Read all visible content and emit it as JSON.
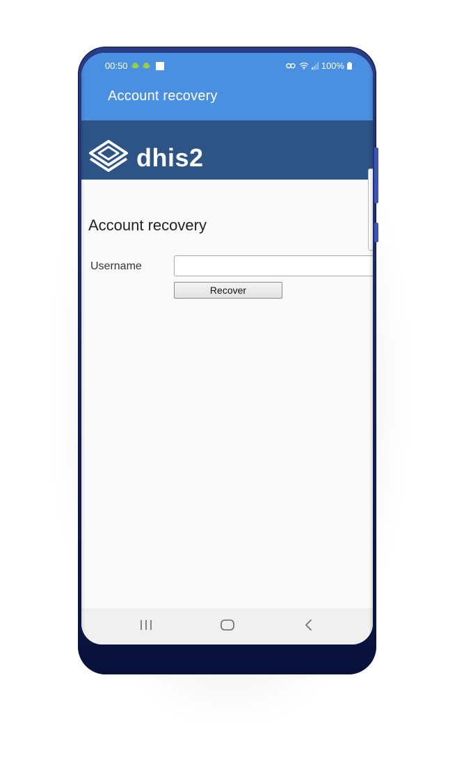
{
  "status_bar": {
    "time": "00:50",
    "battery": "100%"
  },
  "app_bar": {
    "title": "Account recovery"
  },
  "header": {
    "logo_text": "dhis2"
  },
  "form": {
    "title": "Account recovery",
    "username_label": "Username",
    "username_value": "",
    "recover_label": "Recover"
  },
  "nav": {
    "items": [
      "recents",
      "home",
      "back"
    ]
  },
  "colors": {
    "app_bar": "#4a90e2",
    "header": "#2c5485",
    "phone_body": "#14235f",
    "content_bg": "#fafafa"
  }
}
